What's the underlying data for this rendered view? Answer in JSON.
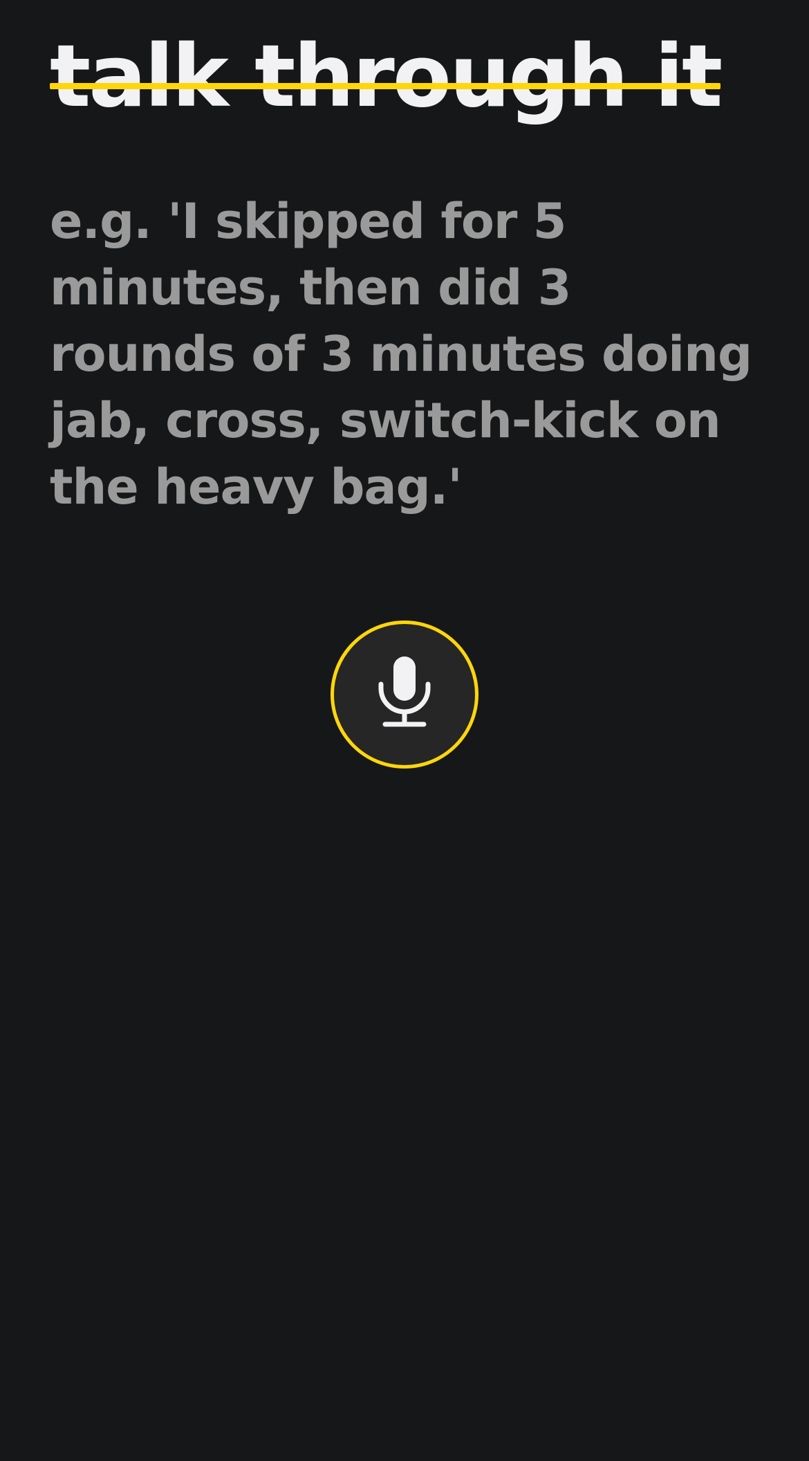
{
  "colors": {
    "background": "#161718",
    "accent": "#ffd60a",
    "title_text": "#f2f2f4",
    "prompt_text": "#9a9a9a",
    "mic_fill": "#262627",
    "mic_icon": "#f2f2f4"
  },
  "header": {
    "title": "talk through it"
  },
  "prompt": {
    "example_text": "e.g. 'I skipped for 5 minutes, then did 3 rounds of 3 minutes doing jab, cross, switch-kick on the heavy bag.'"
  },
  "record": {
    "icon": "microphone-icon"
  }
}
